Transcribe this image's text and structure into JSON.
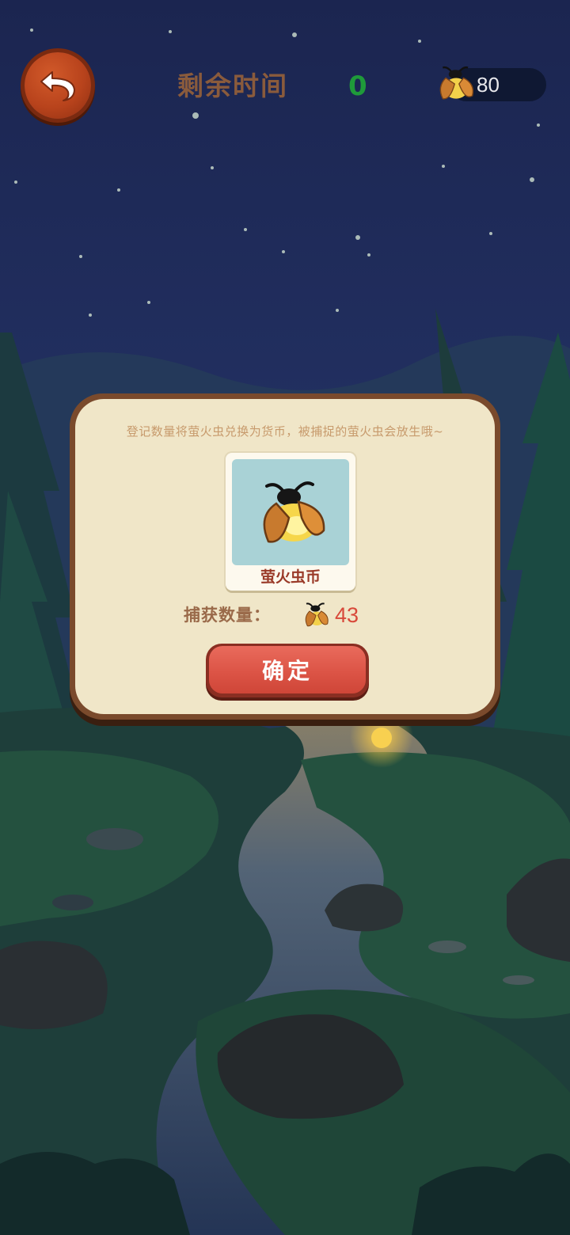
{
  "hud": {
    "back_icon": "undo-arrow-icon",
    "timer_label": "剩余时间",
    "timer_value": "0",
    "coin_icon": "firefly-icon",
    "coin_balance": "80"
  },
  "modal": {
    "message": "登记数量将萤火虫兑换为货币，被捕捉的萤火虫会放生哦~",
    "card_icon": "firefly-icon",
    "card_label": "萤火虫币",
    "count_label": "捕获数量：",
    "count_icon": "firefly-icon",
    "count_value": "43",
    "confirm_label": "确定"
  },
  "colors": {
    "sky": "#1a2448",
    "modal_bg": "#f0e6c8",
    "button_red": "#dc5446",
    "timer_green": "#1f9a3a",
    "count_red": "#d8493a"
  }
}
